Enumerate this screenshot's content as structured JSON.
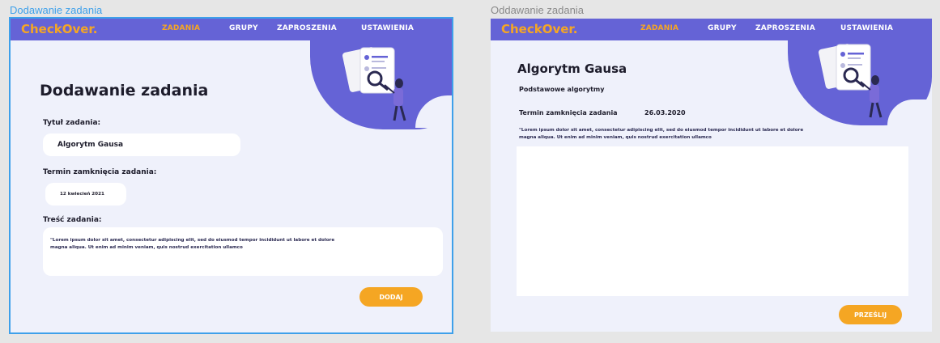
{
  "frames": {
    "left": {
      "label": "Dodawanie zadania",
      "label_color": "#3ea0ea",
      "nav": {
        "logo": "CheckOver.",
        "items": [
          "ZADANIA",
          "GRUPY",
          "ZAPROSZENIA",
          "USTAWIENIA"
        ]
      },
      "page_title": "Dodawanie zadania",
      "title_label": "Tytuł zadania:",
      "title_value": "Algorytm Gausa",
      "deadline_label": "Termin  zamknięcia zadania:",
      "deadline_value": "12 kwiecień 2021",
      "content_label": "Treść zadania:",
      "content_line1": "\"Lorem ipsum dolor sit amet, consectetur adipiscing elit, sed do eiusmod tempor incididunt ut labore et dolore",
      "content_line2": "magna aliqua. Ut enim ad minim veniam, quis nostrud exercitation ullamco",
      "button": "DODAJ"
    },
    "right": {
      "label": "Oddawanie zadania",
      "label_color": "#8a8a8a",
      "nav": {
        "logo": "CheckOver.",
        "items": [
          "ZADANIA",
          "GRUPY",
          "ZAPROSZENIA",
          "USTAWIENIA"
        ]
      },
      "task_title": "Algorytm Gausa",
      "task_group": "Podstawowe algorytmy",
      "deadline_label": "Termin  zamknięcia zadania",
      "deadline_value": "26.03.2020",
      "content_line1": "\"Lorem ipsum dolor sit amet, consectetur adipiscing elit, sed do eiusmod tempor incididunt ut labore et dolore",
      "content_line2": "magna aliqua. Ut enim ad minim veniam, quis nostrud exercitation ullamco",
      "button": "PRZEŚLIJ"
    }
  },
  "colors": {
    "brand": "#6563d6",
    "accent": "#f5a623",
    "background": "#eff1fb",
    "selection": "#3ea0ea"
  }
}
